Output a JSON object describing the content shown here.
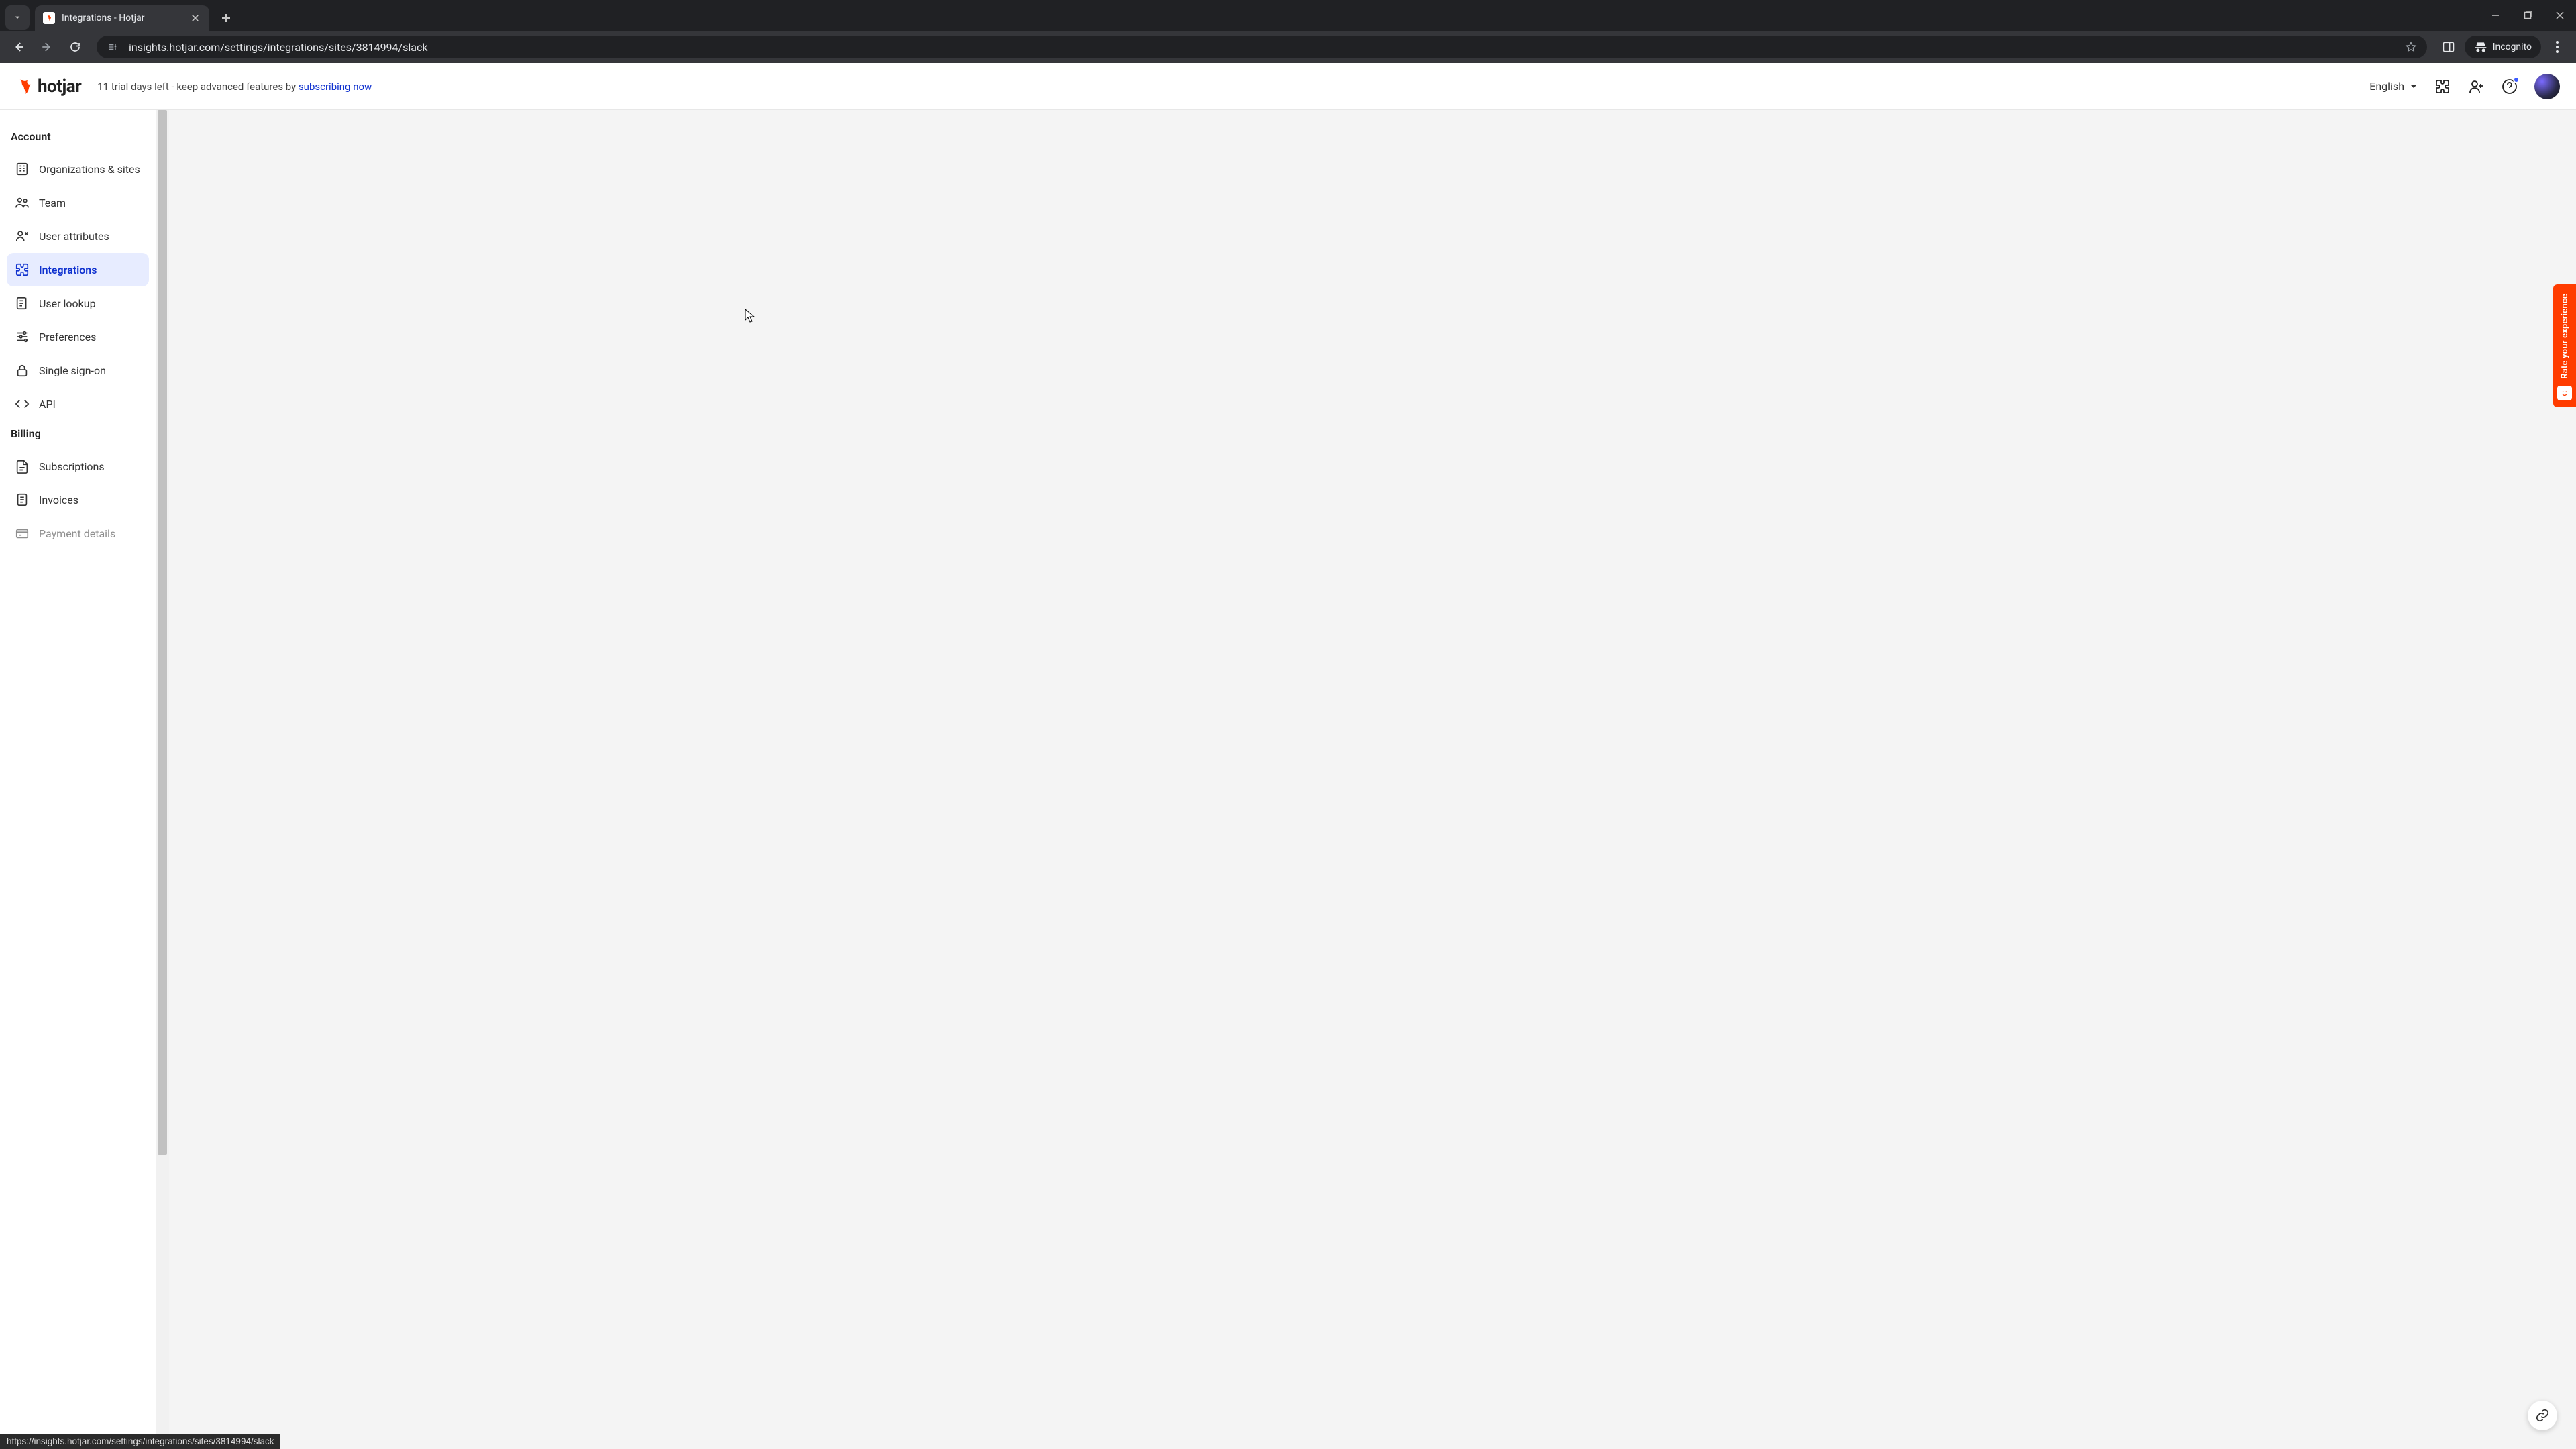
{
  "browser": {
    "tab_title": "Integrations - Hotjar",
    "url": "insights.hotjar.com/settings/integrations/sites/3814994/slack",
    "incognito_label": "Incognito",
    "status_url": "https://insights.hotjar.com/settings/integrations/sites/3814994/slack"
  },
  "topbar": {
    "logo_text": "hotjar",
    "trial_prefix": "11 trial days left - keep advanced features by ",
    "trial_link": "subscribing now",
    "language": "English"
  },
  "sidebar": {
    "sections": [
      {
        "heading": "Account",
        "items": [
          {
            "id": "orgs",
            "label": "Organizations & sites",
            "active": false
          },
          {
            "id": "team",
            "label": "Team",
            "active": false
          },
          {
            "id": "user-attrs",
            "label": "User attributes",
            "active": false
          },
          {
            "id": "integrations",
            "label": "Integrations",
            "active": true
          },
          {
            "id": "user-lookup",
            "label": "User lookup",
            "active": false
          },
          {
            "id": "preferences",
            "label": "Preferences",
            "active": false
          },
          {
            "id": "sso",
            "label": "Single sign-on",
            "active": false
          },
          {
            "id": "api",
            "label": "API",
            "active": false
          }
        ]
      },
      {
        "heading": "Billing",
        "items": [
          {
            "id": "subscriptions",
            "label": "Subscriptions",
            "active": false
          },
          {
            "id": "invoices",
            "label": "Invoices",
            "active": false
          },
          {
            "id": "payment-details",
            "label": "Payment details",
            "active": false,
            "faded": true
          }
        ]
      }
    ]
  },
  "feedback": {
    "label": "Rate your experience"
  }
}
